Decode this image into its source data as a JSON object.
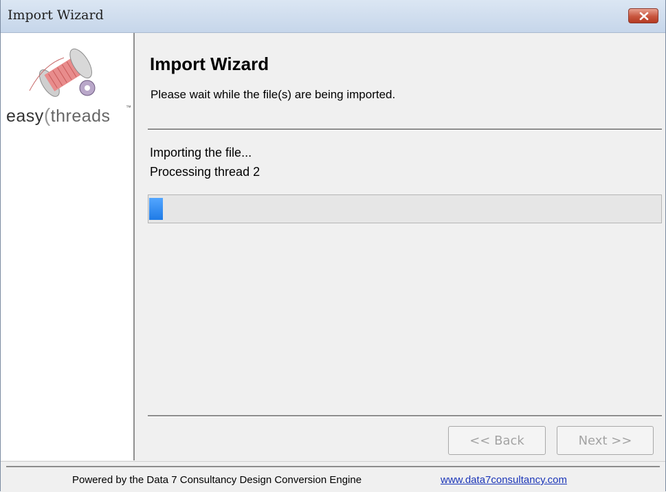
{
  "window": {
    "title": "Import Wizard"
  },
  "sidebar": {
    "logo_word1": "easy",
    "logo_word2": "threads",
    "logo_tm": "™"
  },
  "main": {
    "heading": "Import Wizard",
    "subheading": "Please wait while the file(s) are being imported.",
    "status_line1": "Importing the file...",
    "status_line2": "Processing thread 2",
    "progress_fraction": 0.02
  },
  "buttons": {
    "back_label": "<< Back",
    "next_label": "Next >>"
  },
  "footer": {
    "powered_by": "Powered by the Data 7 Consultancy Design Conversion Engine",
    "link": "www.data7consultancy.com"
  },
  "colors": {
    "titlebar": "#c6d6ea",
    "close_button": "#c8553d",
    "progress_fill": "#2f8cf0",
    "link": "#1a35b8"
  },
  "icons": {
    "close": "close-icon",
    "logo": "thread-spool-logo"
  }
}
